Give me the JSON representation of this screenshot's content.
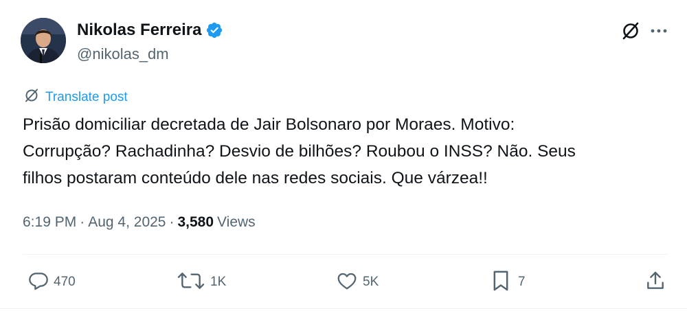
{
  "author": {
    "name": "Nikolas Ferreira",
    "handle": "@nikolas_dm"
  },
  "translate_label": "Translate post",
  "post_text": "Prisão domiciliar decretada de Jair Bolsonaro por Moraes. Motivo:\nCorrupção? Rachadinha? Desvio de bilhões? Roubou o INSS? Não. Seus\nfilhos postaram conteúdo dele nas redes sociais. Que várzea!!",
  "meta": {
    "time": "6:19 PM",
    "separator": "·",
    "date": "Aug 4, 2025",
    "views_count": "3,580",
    "views_label": "Views"
  },
  "actions": {
    "replies": "470",
    "reposts": "1K",
    "likes": "5K",
    "bookmarks": "7"
  },
  "icons": [
    "verified-badge-icon",
    "grok-icon",
    "more-icon",
    "translate-icon",
    "reply-icon",
    "repost-icon",
    "like-icon",
    "bookmark-icon",
    "share-icon"
  ],
  "colors": {
    "accent": "#1d9bf0",
    "text": "#0f1419",
    "secondary": "#536471"
  }
}
